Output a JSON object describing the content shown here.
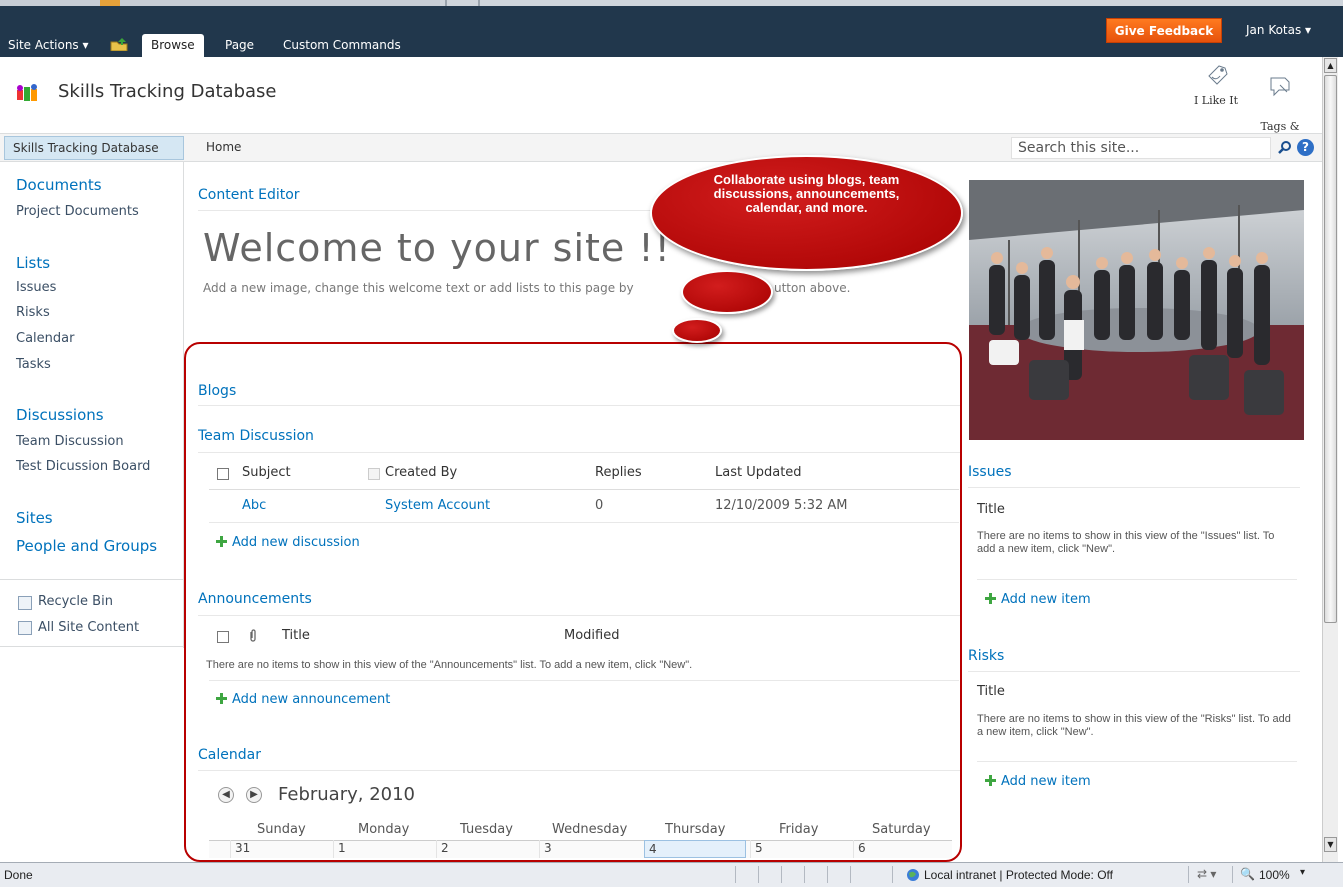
{
  "ribbon": {
    "site_actions": "Site Actions ▾",
    "tabs": [
      "Browse",
      "Page",
      "Custom Commands"
    ],
    "feedback": "Give Feedback",
    "user": "Jan Kotas ▾"
  },
  "site": {
    "title": "Skills Tracking Database",
    "tools": [
      {
        "label": "I Like It"
      },
      {
        "label": "Tags &\nNotes"
      }
    ]
  },
  "nav": {
    "site_tab": "Skills Tracking Database",
    "home": "Home",
    "search_placeholder": "Search this site...",
    "help": "?"
  },
  "quicklaunch": {
    "documents_head": "Documents",
    "documents": [
      "Project Documents"
    ],
    "lists_head": "Lists",
    "lists": [
      "Issues",
      "Risks",
      "Calendar",
      "Tasks"
    ],
    "discussions_head": "Discussions",
    "discussions": [
      "Team Discussion",
      "Test Dicussion Board"
    ],
    "sites": "Sites",
    "people": "People and Groups",
    "recycle": "Recycle Bin",
    "all_content": "All Site Content"
  },
  "content_editor": {
    "title": "Content Editor",
    "welcome": "Welcome to your site !!",
    "welcome_left": "Add a new image, change this welcome text or add lists to this page by",
    "welcome_right": "utton above."
  },
  "blogs": {
    "title": "Blogs"
  },
  "team_discussion": {
    "title": "Team Discussion",
    "columns": [
      "Subject",
      "Created By",
      "Replies",
      "Last Updated"
    ],
    "rows": [
      {
        "subject": "Abc",
        "created_by": "System Account",
        "replies": "0",
        "updated": "12/10/2009 5:32 AM"
      }
    ],
    "add": "Add new discussion"
  },
  "announcements": {
    "title": "Announcements",
    "columns": [
      "Title",
      "Modified"
    ],
    "empty": "There are no items to show in this view of the \"Announcements\" list. To add a new item, click \"New\".",
    "add": "Add new announcement"
  },
  "calendar": {
    "title": "Calendar",
    "month": "February, 2010",
    "days": [
      "Sunday",
      "Monday",
      "Tuesday",
      "Wednesday",
      "Thursday",
      "Friday",
      "Saturday"
    ],
    "dates": [
      "31",
      "1",
      "2",
      "3",
      "4",
      "5",
      "6"
    ]
  },
  "issues": {
    "title": "Issues",
    "column": "Title",
    "empty": "There are no items to show in this view of the \"Issues\" list. To add a new item, click \"New\".",
    "add": "Add new item"
  },
  "risks": {
    "title": "Risks",
    "column": "Title",
    "empty": "There are no items to show in this view of the \"Risks\" list. To add a new item, click \"New\".",
    "add": "Add new item"
  },
  "callout": {
    "text": "Collaborate using blogs, team discussions, announcements, calendar, and more."
  },
  "statusbar": {
    "status": "Done",
    "zone": "Local intranet | Protected Mode: Off",
    "zoom": "100%"
  },
  "colors": {
    "ribbon": "#21374c",
    "link": "#0072bc",
    "callout": "#b80000",
    "feedback": "#f26c18"
  },
  "icons": [
    "site-logo-icon",
    "i-like-it-icon",
    "tags-notes-icon",
    "search-icon",
    "help-icon",
    "recycle-bin-icon",
    "all-site-content-icon",
    "add-plus-icon",
    "attachment-icon",
    "calendar-prev-icon",
    "calendar-next-icon",
    "globe-icon"
  ]
}
